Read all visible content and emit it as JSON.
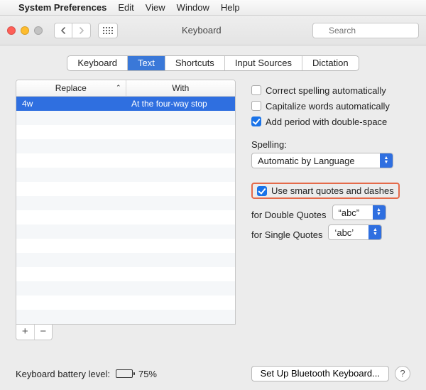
{
  "menubar": {
    "app": "System Preferences",
    "items": [
      "Edit",
      "View",
      "Window",
      "Help"
    ]
  },
  "toolbar": {
    "title": "Keyboard",
    "search_placeholder": "Search"
  },
  "tabs": [
    "Keyboard",
    "Text",
    "Shortcuts",
    "Input Sources",
    "Dictation"
  ],
  "active_tab_index": 1,
  "table": {
    "columns": [
      "Replace",
      "With"
    ],
    "rows": [
      {
        "replace": "4w",
        "with": "At the four-way stop",
        "selected": true
      }
    ]
  },
  "checks": {
    "correct_spelling": {
      "label": "Correct spelling automatically",
      "checked": false
    },
    "capitalize": {
      "label": "Capitalize words automatically",
      "checked": false
    },
    "add_period": {
      "label": "Add period with double-space",
      "checked": true
    },
    "smart_quotes": {
      "label": "Use smart quotes and dashes",
      "checked": true
    }
  },
  "spelling": {
    "label": "Spelling:",
    "value": "Automatic by Language"
  },
  "double_quotes": {
    "label": "for Double Quotes",
    "value": "“abc”"
  },
  "single_quotes": {
    "label": "for Single Quotes",
    "value": "‘abc’"
  },
  "footer": {
    "battery_label": "Keyboard battery level:",
    "battery_pct": "75%",
    "battery_fill_pct": 75,
    "bluetooth_btn": "Set Up Bluetooth Keyboard..."
  }
}
